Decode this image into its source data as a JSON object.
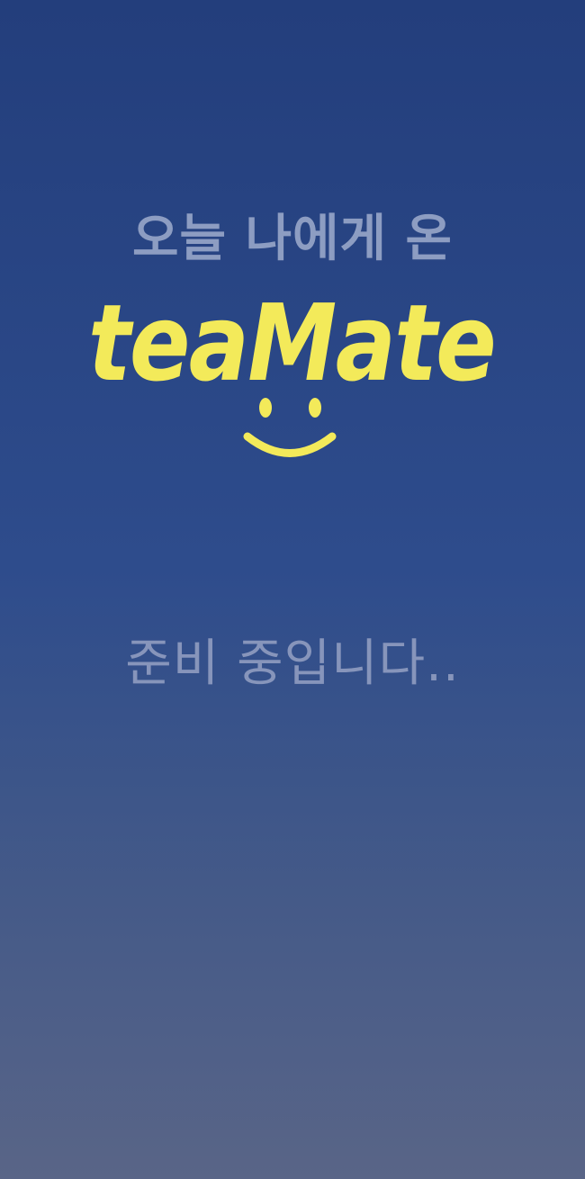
{
  "splash": {
    "tagline": "오늘 나에게 온",
    "logo_text": "teaMate",
    "status": "준비 중입니다.."
  },
  "colors": {
    "background_top": "#233e7c",
    "background_bottom": "#596587",
    "logo": "#f3ea5a",
    "text_muted": "#8d9dc2"
  },
  "icons": {
    "logo_mark": "smiley-face-icon"
  }
}
